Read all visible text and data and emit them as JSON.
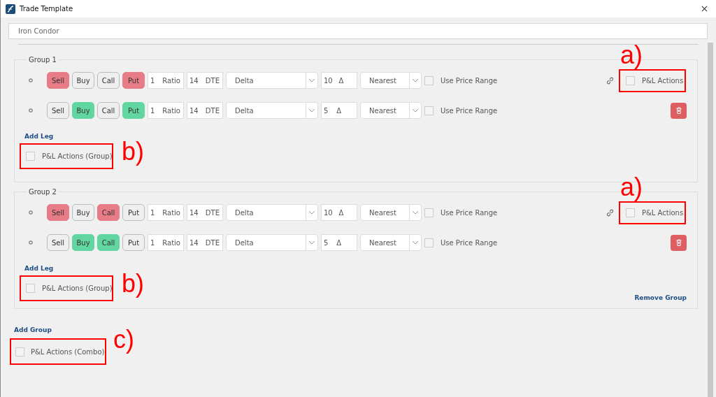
{
  "window": {
    "title": "Trade Template"
  },
  "template_name": {
    "value": "Iron Condor"
  },
  "groups": [
    {
      "title": "Group 1",
      "legs": [
        {
          "buttons": [
            {
              "label": "Sell",
              "selected": true
            },
            {
              "label": "Buy",
              "selected": false
            },
            {
              "label": "Call",
              "selected": false
            },
            {
              "label": "Put",
              "selected": true
            }
          ],
          "ratio": {
            "value": "1",
            "unit": "Ratio"
          },
          "dte": {
            "value": "14",
            "unit": "DTE"
          },
          "method": "Delta",
          "delta": {
            "value": "10",
            "unit": "Δ"
          },
          "rounding": "Nearest",
          "price_range": {
            "label": "Use Price Range",
            "checked": false
          },
          "kind": "pnl",
          "pnl_actions": {
            "label": "P&L Actions",
            "checked": false,
            "annotation": "a)"
          }
        },
        {
          "buttons": [
            {
              "label": "Sell",
              "selected": false
            },
            {
              "label": "Buy",
              "selected": true
            },
            {
              "label": "Call",
              "selected": false
            },
            {
              "label": "Put",
              "selected": true
            }
          ],
          "ratio": {
            "value": "1",
            "unit": "Ratio"
          },
          "dte": {
            "value": "14",
            "unit": "DTE"
          },
          "method": "Delta",
          "delta": {
            "value": "5",
            "unit": "Δ"
          },
          "rounding": "Nearest",
          "price_range": {
            "label": "Use Price Range",
            "checked": false
          },
          "kind": "delete"
        }
      ],
      "add_leg": "Add Leg",
      "pnl_group": {
        "label": "P&L Actions (Group)",
        "checked": false,
        "annotation": "b)"
      }
    },
    {
      "title": "Group 2",
      "legs": [
        {
          "buttons": [
            {
              "label": "Sell",
              "selected": true
            },
            {
              "label": "Buy",
              "selected": false
            },
            {
              "label": "Call",
              "selected": true
            },
            {
              "label": "Put",
              "selected": false
            }
          ],
          "ratio": {
            "value": "1",
            "unit": "Ratio"
          },
          "dte": {
            "value": "14",
            "unit": "DTE"
          },
          "method": "Delta",
          "delta": {
            "value": "10",
            "unit": "Δ"
          },
          "rounding": "Nearest",
          "price_range": {
            "label": "Use Price Range",
            "checked": false
          },
          "kind": "pnl",
          "pnl_actions": {
            "label": "P&L Actions",
            "checked": false,
            "annotation": "a)"
          }
        },
        {
          "buttons": [
            {
              "label": "Sell",
              "selected": false
            },
            {
              "label": "Buy",
              "selected": true
            },
            {
              "label": "Call",
              "selected": true
            },
            {
              "label": "Put",
              "selected": false
            }
          ],
          "ratio": {
            "value": "1",
            "unit": "Ratio"
          },
          "dte": {
            "value": "14",
            "unit": "DTE"
          },
          "method": "Delta",
          "delta": {
            "value": "5",
            "unit": "Δ"
          },
          "rounding": "Nearest",
          "price_range": {
            "label": "Use Price Range",
            "checked": false
          },
          "kind": "delete"
        }
      ],
      "add_leg": "Add Leg",
      "pnl_group": {
        "label": "P&L Actions (Group)",
        "checked": false,
        "annotation": "b)"
      },
      "remove_group": "Remove Group"
    }
  ],
  "add_group": "Add Group",
  "pnl_combo": {
    "label": "P&L Actions (Combo)",
    "checked": false,
    "annotation": "c)"
  }
}
